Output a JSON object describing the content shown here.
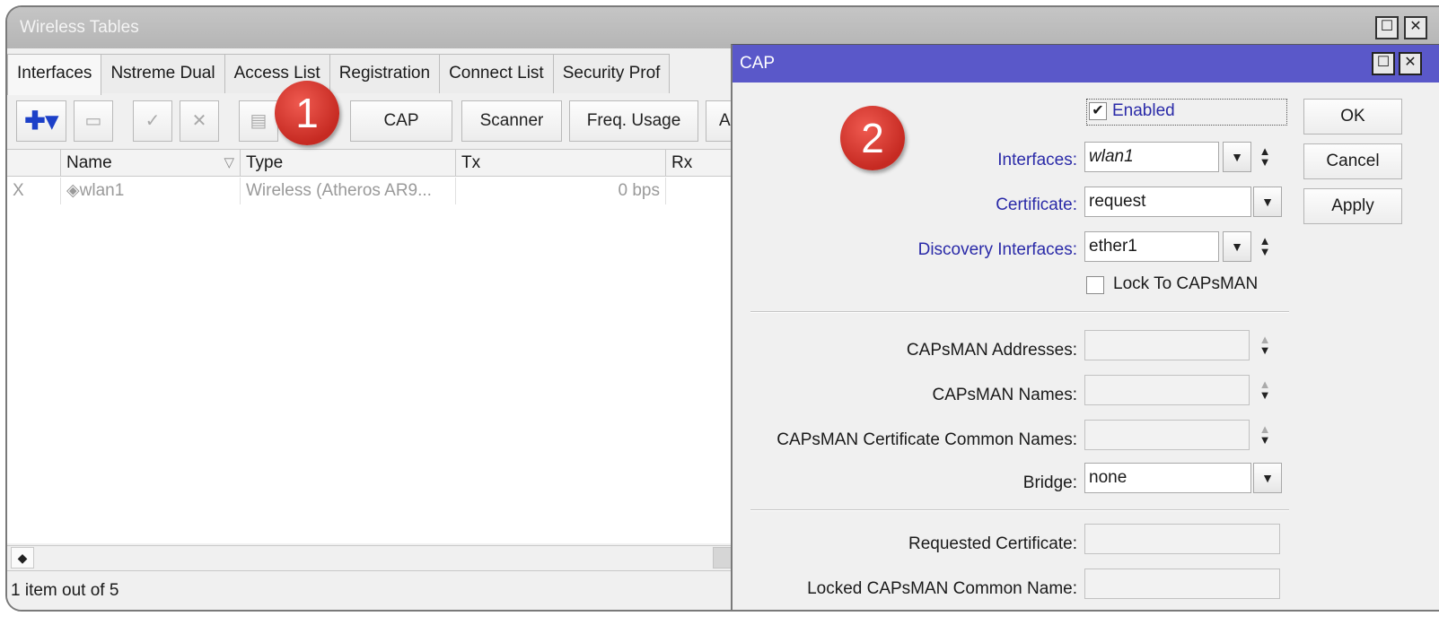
{
  "wireless_tables": {
    "title": "Wireless Tables",
    "window_buttons": [
      "☐",
      "✕"
    ],
    "tabs": [
      "Interfaces",
      "Nstreme Dual",
      "Access List",
      "Registration",
      "Connect List",
      "Security Prof"
    ],
    "toolbar": {
      "add_icon": "✚▾",
      "remove_icon": "▭",
      "enable_icon": "✓",
      "disable_icon": "✕",
      "comment_icon": "▤",
      "cap_label": "CAP",
      "scanner_label": "Scanner",
      "freq_usage_label": "Freq. Usage",
      "cutoff_label": "A"
    },
    "columns": [
      "Name",
      "Type",
      "Tx",
      "Rx"
    ],
    "sort_icon": "▽",
    "rows": [
      {
        "flag": "X",
        "icon": "◈",
        "name": "wlan1",
        "type": "Wireless (Atheros AR9...",
        "tx": "0 bps",
        "rx": ""
      }
    ],
    "scroll_left_icon": "◆",
    "status": "1 item out of 5"
  },
  "badges": {
    "one": "1",
    "two": "2"
  },
  "cap_dialog": {
    "title": "CAP",
    "window_buttons": [
      "☐",
      "✕"
    ],
    "enabled": {
      "label": "Enabled",
      "checked": true,
      "check_mark": "✔"
    },
    "interfaces": {
      "label": "Interfaces:",
      "value": "wlan1"
    },
    "certificate": {
      "label": "Certificate:",
      "value": "request"
    },
    "discovery_interfaces": {
      "label": "Discovery Interfaces:",
      "value": "ether1"
    },
    "lock_to_capsman": {
      "label": "Lock To CAPsMAN",
      "checked": false
    },
    "capsman_addresses": {
      "label": "CAPsMAN Addresses:",
      "value": ""
    },
    "capsman_names": {
      "label": "CAPsMAN Names:",
      "value": ""
    },
    "capsman_cert_common_names": {
      "label": "CAPsMAN Certificate Common Names:",
      "value": ""
    },
    "bridge": {
      "label": "Bridge:",
      "value": "none"
    },
    "requested_certificate": {
      "label": "Requested Certificate:",
      "value": ""
    },
    "locked_capsman_common_name": {
      "label": "Locked CAPsMAN Common Name:",
      "value": ""
    },
    "dropdown_icon": "▼",
    "updown_up": "▲",
    "updown_down": "▼",
    "buttons": {
      "ok": "OK",
      "cancel": "Cancel",
      "apply": "Apply"
    }
  }
}
